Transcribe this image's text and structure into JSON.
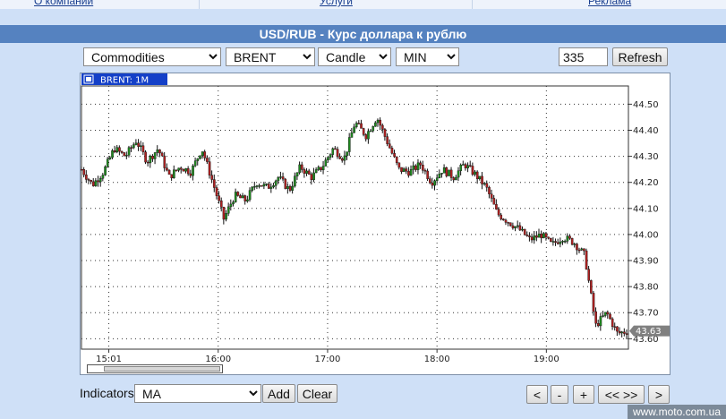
{
  "nav": {
    "items": [
      {
        "label": "О компании"
      },
      {
        "label": "Услуги"
      },
      {
        "label": "Реклама"
      }
    ]
  },
  "title": "USD/RUB - Курс доллара к рублю",
  "controls": {
    "group_select": "Commodities",
    "symbol_select": "BRENT",
    "chart_type_select": "Candle",
    "period_select": "MIN",
    "count_value": "335",
    "refresh_label": "Refresh"
  },
  "chart_data": {
    "type": "candlestick",
    "tab_label": "BRENT: 1M",
    "last_price_label": "43.63",
    "y_ticks": [
      "44.50",
      "44.40",
      "44.30",
      "44.20",
      "44.10",
      "44.00",
      "43.90",
      "43.80",
      "43.70",
      "43.60"
    ],
    "ylim": [
      43.56,
      44.57
    ],
    "x_ticks": [
      {
        "label": "15:01",
        "min": 15
      },
      {
        "label": "16:00",
        "min": 75
      },
      {
        "label": "17:00",
        "min": 135
      },
      {
        "label": "18:00",
        "min": 195
      },
      {
        "label": "19:00",
        "min": 255
      }
    ],
    "x_range": [
      0,
      300
    ],
    "grid": true,
    "colors": {
      "up": "#1f8a1f",
      "down": "#b02020",
      "grid": "#333333",
      "label_bg": "#808080"
    },
    "close_path": [
      [
        0,
        44.25
      ],
      [
        6,
        44.19
      ],
      [
        12,
        44.24
      ],
      [
        18,
        44.33
      ],
      [
        24,
        44.3
      ],
      [
        30,
        44.36
      ],
      [
        36,
        44.28
      ],
      [
        42,
        44.33
      ],
      [
        48,
        44.22
      ],
      [
        54,
        44.26
      ],
      [
        60,
        44.24
      ],
      [
        66,
        44.33
      ],
      [
        72,
        44.2
      ],
      [
        78,
        44.06
      ],
      [
        84,
        44.15
      ],
      [
        90,
        44.13
      ],
      [
        96,
        44.2
      ],
      [
        102,
        44.18
      ],
      [
        108,
        44.22
      ],
      [
        114,
        44.17
      ],
      [
        120,
        44.26
      ],
      [
        126,
        44.22
      ],
      [
        132,
        44.26
      ],
      [
        138,
        44.33
      ],
      [
        144,
        44.29
      ],
      [
        150,
        44.43
      ],
      [
        156,
        44.38
      ],
      [
        162,
        44.45
      ],
      [
        168,
        44.35
      ],
      [
        174,
        44.25
      ],
      [
        180,
        44.24
      ],
      [
        186,
        44.27
      ],
      [
        192,
        44.2
      ],
      [
        198,
        44.25
      ],
      [
        204,
        44.22
      ],
      [
        210,
        44.27
      ],
      [
        216,
        44.23
      ],
      [
        222,
        44.18
      ],
      [
        228,
        44.08
      ],
      [
        234,
        44.05
      ],
      [
        240,
        44.02
      ],
      [
        246,
        43.98
      ],
      [
        252,
        44.0
      ],
      [
        258,
        43.96
      ],
      [
        264,
        43.99
      ],
      [
        270,
        43.97
      ],
      [
        276,
        43.92
      ],
      [
        282,
        43.65
      ],
      [
        288,
        43.7
      ],
      [
        294,
        43.62
      ],
      [
        300,
        43.63
      ]
    ]
  },
  "indicators": {
    "label": "Indicators",
    "select": "MA",
    "add_label": "Add",
    "clear_label": "Clear"
  },
  "nav_buttons": {
    "back": "<",
    "zoom_out": "-",
    "zoom_in": "+",
    "reset": "<< >>",
    "forward": ">"
  },
  "watermark": "www.moto.com.ua"
}
